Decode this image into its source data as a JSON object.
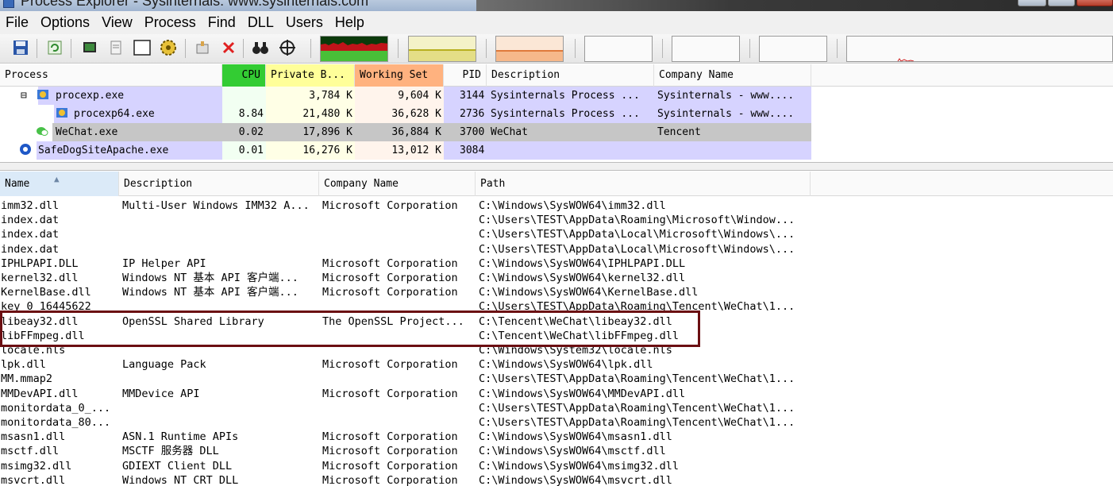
{
  "window": {
    "title": "Process Explorer - Sysinternals: www.sysinternals.com"
  },
  "menu": [
    "File",
    "Options",
    "View",
    "Process",
    "Find",
    "DLL",
    "Users",
    "Help"
  ],
  "toolbar": {
    "buttons": [
      {
        "name": "save-icon",
        "glyph": "💾"
      },
      {
        "name": "refresh-icon",
        "glyph": "⟳"
      },
      {
        "name": "system-info-icon",
        "glyph": "▤"
      },
      {
        "name": "properties-icon",
        "glyph": "▯"
      },
      {
        "name": "window-icon",
        "glyph": "☐"
      },
      {
        "name": "gear-icon",
        "glyph": "⚙"
      },
      {
        "name": "handle-icon",
        "glyph": "☝"
      },
      {
        "name": "kill-process-icon",
        "glyph": "✕"
      },
      {
        "name": "find-binoculars-icon",
        "glyph": "⚲"
      },
      {
        "name": "crosshair-icon",
        "glyph": "⊕"
      }
    ]
  },
  "process_list": {
    "columns": [
      "Process",
      "CPU",
      "Private B...",
      "Working Set",
      "PID",
      "Description",
      "Company Name"
    ],
    "rows": [
      {
        "process": "procexp.exe",
        "cpu": "",
        "private": "3,784 K",
        "working": "9,604 K",
        "pid": "3144",
        "description": "Sysinternals Process ...",
        "company": "Sysinternals - www....",
        "expander": "⊟",
        "indent": 1,
        "color": "#d6d3ff"
      },
      {
        "process": "procexp64.exe",
        "cpu": "8.84",
        "private": "21,480 K",
        "working": "36,628 K",
        "pid": "2736",
        "description": "Sysinternals Process ...",
        "company": "Sysinternals - www....",
        "expander": "",
        "indent": 2,
        "color": "#d6d3ff"
      },
      {
        "process": "WeChat.exe",
        "cpu": "0.02",
        "private": "17,896 K",
        "working": "36,884 K",
        "pid": "3700",
        "description": "WeChat",
        "company": "Tencent",
        "expander": "",
        "indent": 1,
        "color": "#c6c6c6"
      },
      {
        "process": "SafeDogSiteApache.exe",
        "cpu": "0.01",
        "private": "16,276 K",
        "working": "13,012 K",
        "pid": "3084",
        "description": "",
        "company": "",
        "expander": "",
        "indent": 0,
        "color": "#d6d3ff"
      }
    ]
  },
  "dll_list": {
    "columns": [
      "Name",
      "Description",
      "Company Name",
      "Path"
    ],
    "rows": [
      {
        "name": "imm32.dll",
        "description": "Multi-User Windows IMM32 A...",
        "company": "Microsoft Corporation",
        "path": "C:\\Windows\\SysWOW64\\imm32.dll"
      },
      {
        "name": "index.dat",
        "description": "",
        "company": "",
        "path": "C:\\Users\\TEST\\AppData\\Roaming\\Microsoft\\Window..."
      },
      {
        "name": "index.dat",
        "description": "",
        "company": "",
        "path": "C:\\Users\\TEST\\AppData\\Local\\Microsoft\\Windows\\..."
      },
      {
        "name": "index.dat",
        "description": "",
        "company": "",
        "path": "C:\\Users\\TEST\\AppData\\Local\\Microsoft\\Windows\\..."
      },
      {
        "name": "IPHLPAPI.DLL",
        "description": "IP Helper API",
        "company": "Microsoft Corporation",
        "path": "C:\\Windows\\SysWOW64\\IPHLPAPI.DLL"
      },
      {
        "name": "kernel32.dll",
        "description": "Windows NT 基本 API 客户端...",
        "company": "Microsoft Corporation",
        "path": "C:\\Windows\\SysWOW64\\kernel32.dll"
      },
      {
        "name": "KernelBase.dll",
        "description": "Windows NT 基本 API 客户端...",
        "company": "Microsoft Corporation",
        "path": "C:\\Windows\\SysWOW64\\KernelBase.dll"
      },
      {
        "name": "key_0_16445622",
        "description": "",
        "company": "",
        "path": "C:\\Users\\TEST\\AppData\\Roaming\\Tencent\\WeChat\\1..."
      },
      {
        "name": "libeay32.dll",
        "description": "OpenSSL Shared Library",
        "company": "The OpenSSL Project...",
        "path": "C:\\Tencent\\WeChat\\libeay32.dll"
      },
      {
        "name": "libFFmpeg.dll",
        "description": "",
        "company": "",
        "path": "C:\\Tencent\\WeChat\\libFFmpeg.dll"
      },
      {
        "name": "locale.nls",
        "description": "",
        "company": "",
        "path": "C:\\Windows\\System32\\locale.nls"
      },
      {
        "name": "lpk.dll",
        "description": "Language Pack",
        "company": "Microsoft Corporation",
        "path": "C:\\Windows\\SysWOW64\\lpk.dll"
      },
      {
        "name": "MM.mmap2",
        "description": "",
        "company": "",
        "path": "C:\\Users\\TEST\\AppData\\Roaming\\Tencent\\WeChat\\1..."
      },
      {
        "name": "MMDevAPI.dll",
        "description": "MMDevice API",
        "company": "Microsoft Corporation",
        "path": "C:\\Windows\\SysWOW64\\MMDevAPI.dll"
      },
      {
        "name": "monitordata_0_...",
        "description": "",
        "company": "",
        "path": "C:\\Users\\TEST\\AppData\\Roaming\\Tencent\\WeChat\\1..."
      },
      {
        "name": "monitordata_80...",
        "description": "",
        "company": "",
        "path": "C:\\Users\\TEST\\AppData\\Roaming\\Tencent\\WeChat\\1..."
      },
      {
        "name": "msasn1.dll",
        "description": "ASN.1 Runtime APIs",
        "company": "Microsoft Corporation",
        "path": "C:\\Windows\\SysWOW64\\msasn1.dll"
      },
      {
        "name": "msctf.dll",
        "description": "MSCTF 服务器 DLL",
        "company": "Microsoft Corporation",
        "path": "C:\\Windows\\SysWOW64\\msctf.dll"
      },
      {
        "name": "msimg32.dll",
        "description": "GDIEXT Client DLL",
        "company": "Microsoft Corporation",
        "path": "C:\\Windows\\SysWOW64\\msimg32.dll"
      },
      {
        "name": "msvcrt.dll",
        "description": "Windows NT CRT DLL",
        "company": "Microsoft Corporation",
        "path": "C:\\Windows\\SysWOW64\\msvcrt.dll"
      }
    ],
    "highlighted_rows": [
      "libeay32.dll",
      "libFFmpeg.dll"
    ]
  },
  "colors": {
    "cpu_header": "#33cc33",
    "private_header": "#ffff99",
    "working_header": "#ffb27f",
    "service_row": "#d6d3ff",
    "highlight_box": "#6b0f12"
  }
}
